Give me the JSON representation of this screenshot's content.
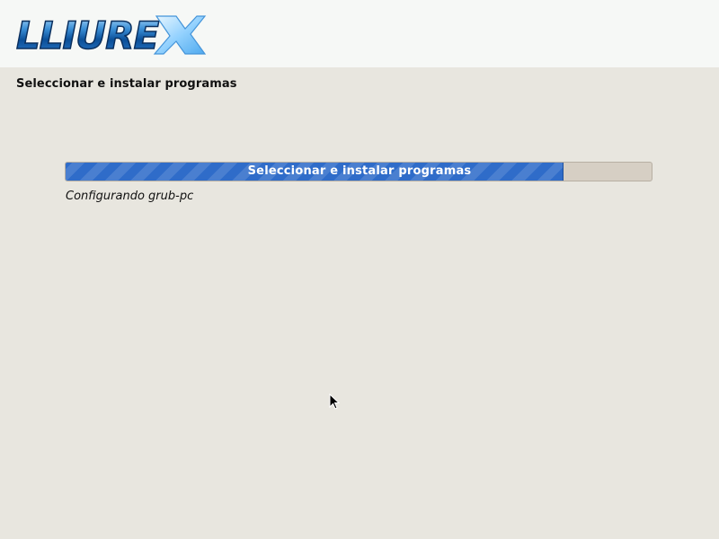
{
  "header": {
    "logo_text": "LLIUREX"
  },
  "page": {
    "title": "Seleccionar e instalar programas"
  },
  "progress": {
    "label": "Seleccionar e instalar programas",
    "fraction": 0.85,
    "status": "Configurando grub-pc"
  },
  "colors": {
    "background": "#e8e6df",
    "header_background": "#f6f8f6",
    "progress_fill": "#2f6cc9",
    "progress_track": "#d6cfc4"
  },
  "icons": {
    "cursor": "mouse-pointer-icon"
  }
}
